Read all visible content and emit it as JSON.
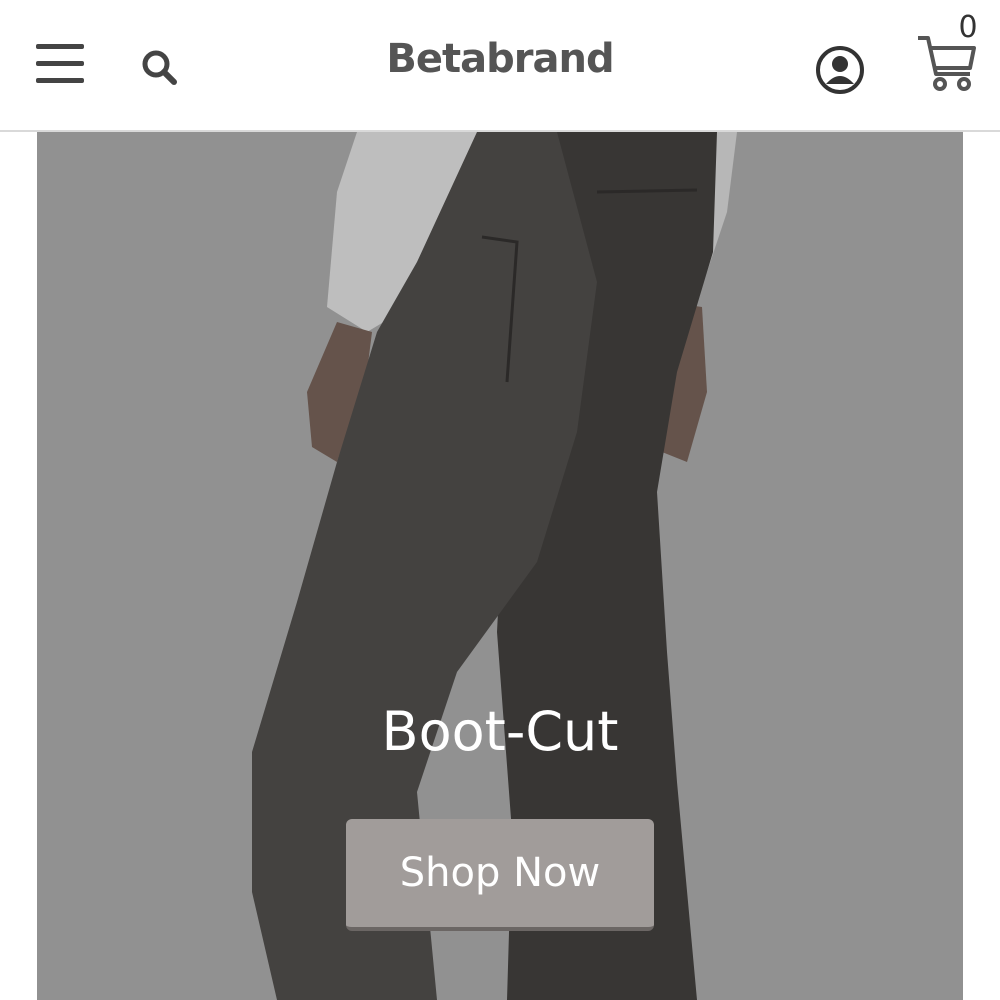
{
  "header": {
    "menu_icon": "hamburger-menu-icon",
    "search_icon": "search-icon",
    "logo_text": "Betabrand",
    "account_icon": "user-account-icon",
    "cart_icon": "shopping-cart-icon",
    "cart_count": "0"
  },
  "hero": {
    "title": "Boot-Cut",
    "button_label": "Shop Now",
    "background_color": "#9e9e9e",
    "button_color": "#a19c9a"
  }
}
